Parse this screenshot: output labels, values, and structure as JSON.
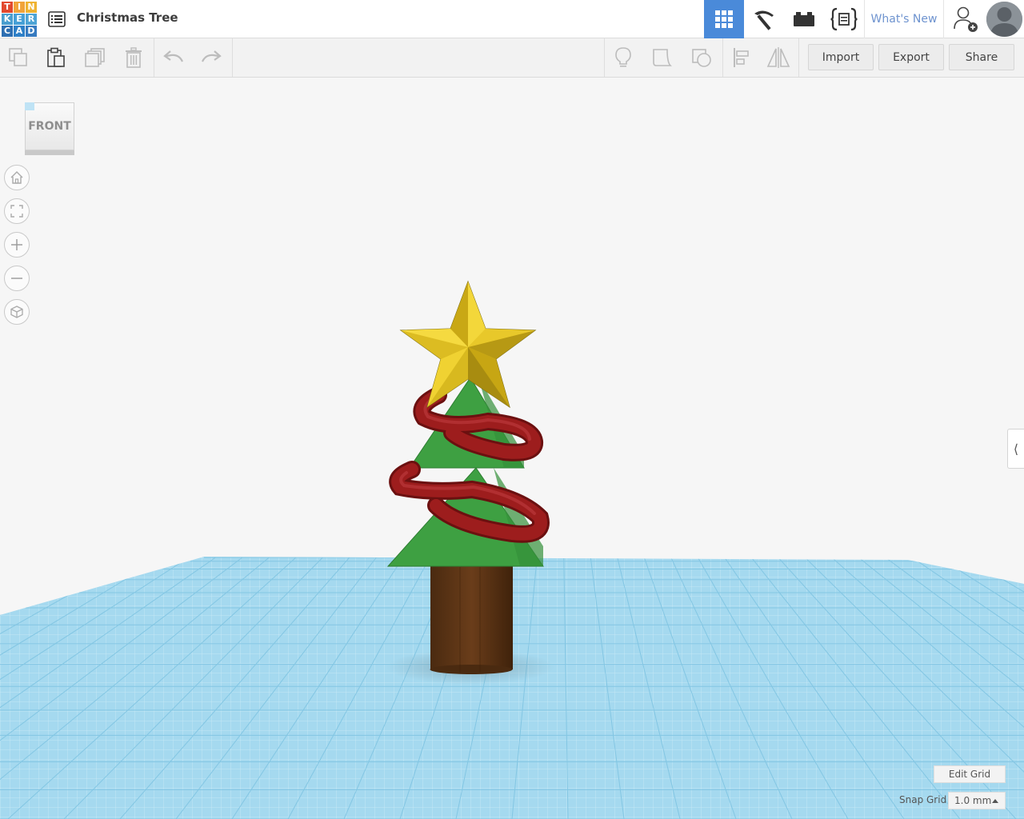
{
  "app": {
    "logo_letters": [
      "T",
      "I",
      "N",
      "K",
      "E",
      "R",
      "C",
      "A",
      "D"
    ],
    "logo_colors": [
      "#e2492f",
      "#f1a33a",
      "#efb332",
      "#4a9ecf",
      "#47a0d6",
      "#4ea4d5",
      "#2e6fb2",
      "#2f80c7",
      "#377bc0"
    ],
    "design_title": "Christmas Tree"
  },
  "header": {
    "views": [
      {
        "name": "3d-design-view",
        "icon": "grid-icon",
        "active": true
      },
      {
        "name": "blocks-view",
        "icon": "pickaxe-icon",
        "active": false
      },
      {
        "name": "bricks-view",
        "icon": "brick-icon",
        "active": false
      },
      {
        "name": "codeblocks-view",
        "icon": "codeblocks-icon",
        "active": false
      }
    ],
    "whats_new": "What's New",
    "accent": "#4a8ad9"
  },
  "toolbar": {
    "tools": [
      "copy-icon",
      "paste-icon",
      "duplicate-icon",
      "delete-icon",
      "undo-icon",
      "redo-icon",
      "notes-icon",
      "group-icon",
      "ungroup-icon",
      "align-icon",
      "mirror-icon"
    ],
    "import": "Import",
    "export": "Export",
    "share": "Share"
  },
  "viewcube": {
    "label": "FRONT"
  },
  "nav_controls": [
    "home-icon",
    "fit-icon",
    "zoom-in-icon",
    "zoom-out-icon",
    "perspective-icon"
  ],
  "grid": {
    "edit_grid": "Edit Grid",
    "snap_label": "Snap Grid",
    "snap_value": "1.0 mm"
  },
  "colors": {
    "workplane": "#9fd6ee",
    "tree": "#3ea042",
    "trunk": "#5a3315",
    "star": "#e2c11f",
    "garland": "#9d1d1d"
  }
}
